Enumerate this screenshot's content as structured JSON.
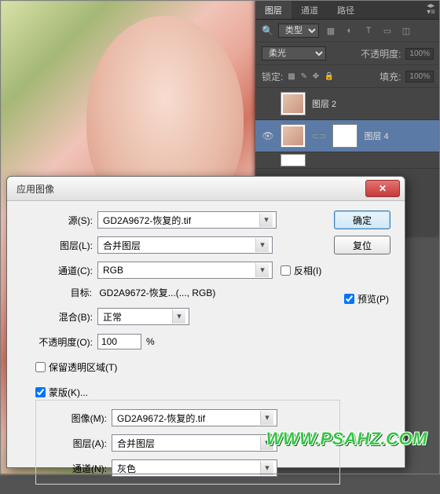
{
  "layersPanel": {
    "tabs": [
      "图层",
      "通道",
      "路径"
    ],
    "activeTab": 0,
    "filterLabel": "类型",
    "blendMode": "柔光",
    "opacityLabel": "不透明度:",
    "opacityValue": "100%",
    "lockLabel": "锁定:",
    "fillLabel": "填充:",
    "fillValue": "100%",
    "layers": [
      {
        "name": "图层 2",
        "visible": false,
        "selected": false
      },
      {
        "name": "图层 4",
        "visible": true,
        "selected": true
      }
    ]
  },
  "dialog": {
    "title": "应用图像",
    "source": {
      "label": "源(S):",
      "value": "GD2A9672-恢复的.tif"
    },
    "layer": {
      "label": "图层(L):",
      "value": "合并图层"
    },
    "channel": {
      "label": "通道(C):",
      "value": "RGB"
    },
    "invert": {
      "label": "反相(I)",
      "checked": false
    },
    "target": {
      "label": "目标:",
      "value": "GD2A9672-恢复...(..., RGB)"
    },
    "blending": {
      "label": "混合(B):",
      "value": "正常"
    },
    "opacity": {
      "label": "不透明度(O):",
      "value": "100",
      "unit": "%"
    },
    "preserveTransparency": {
      "label": "保留透明区域(T)",
      "checked": false
    },
    "mask": {
      "label": "蒙版(K)...",
      "checked": true
    },
    "maskImage": {
      "label": "图像(M):",
      "value": "GD2A9672-恢复的.tif"
    },
    "maskLayer": {
      "label": "图层(A):",
      "value": "合并图层"
    },
    "maskChannel": {
      "label": "通道(N):",
      "value": "灰色"
    },
    "buttons": {
      "ok": "确定",
      "cancel": "复位"
    },
    "preview": {
      "label": "预览(P)",
      "checked": true
    }
  },
  "watermark": "WWW.PSAHZ.COM"
}
